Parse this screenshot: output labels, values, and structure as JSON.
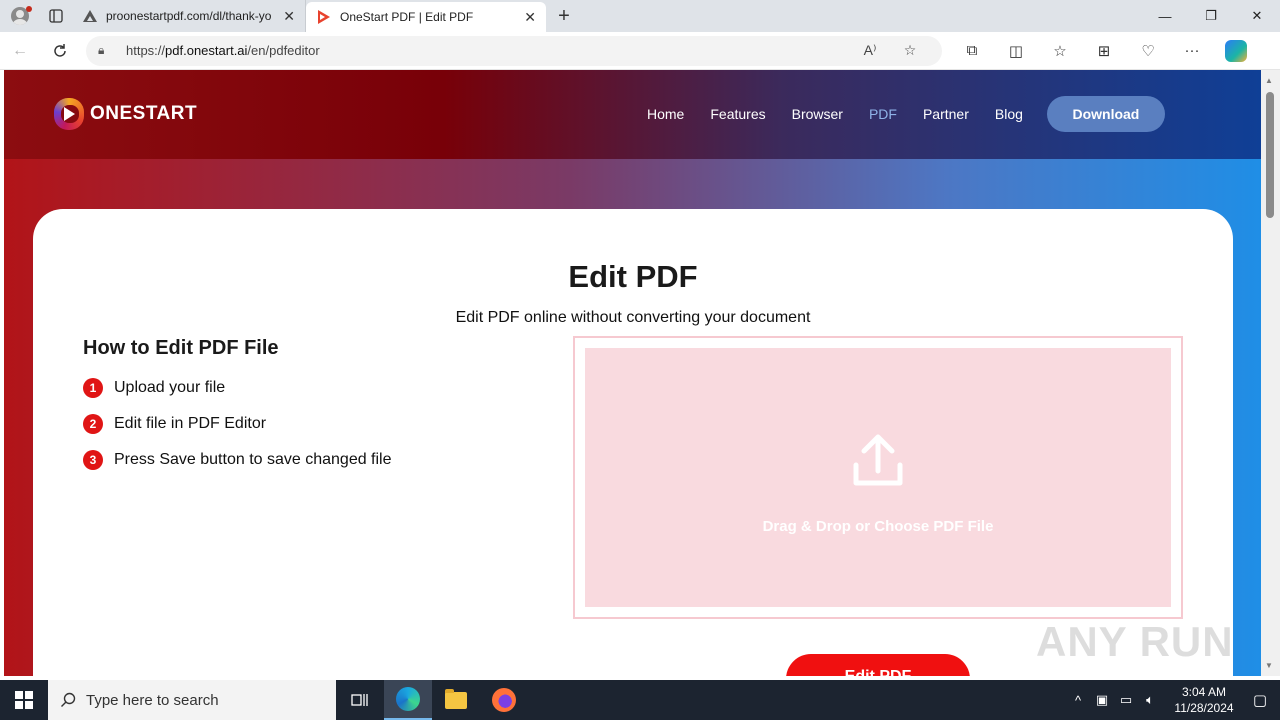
{
  "browser": {
    "tabs": [
      {
        "title": "proonestartpdf.com/dl/thank-yo",
        "active": false
      },
      {
        "title": "OneStart PDF | Edit PDF",
        "active": true
      }
    ],
    "url_prefix": "https://",
    "url_domain": "pdf.onestart.ai",
    "url_path": "/en/pdfeditor"
  },
  "site": {
    "logo_text": "ONESTART",
    "nav": [
      {
        "label": "Home",
        "active": false
      },
      {
        "label": "Features",
        "active": false
      },
      {
        "label": "Browser",
        "active": false
      },
      {
        "label": "PDF",
        "active": true
      },
      {
        "label": "Partner",
        "active": false
      },
      {
        "label": "Blog",
        "active": false
      }
    ],
    "download_label": "Download"
  },
  "main": {
    "title": "Edit PDF",
    "subtitle": "Edit PDF online without converting your document",
    "howto_title": "How to Edit PDF File",
    "steps": [
      {
        "num": "1",
        "text": "Upload your file"
      },
      {
        "num": "2",
        "text": "Edit file in PDF Editor"
      },
      {
        "num": "3",
        "text": "Press Save button to save changed file"
      }
    ],
    "dropzone_text": "Drag & Drop or Choose PDF File",
    "edit_button": "Edit PDF"
  },
  "watermark": "ANY RUN",
  "taskbar": {
    "search_placeholder": "Type here to search",
    "time": "3:04 AM",
    "date": "11/28/2024"
  },
  "colors": {
    "accent_red": "#f01010",
    "step_red": "#e01515",
    "dropzone_bg": "#f9dadf",
    "download_btn": "#5a7fc0"
  }
}
